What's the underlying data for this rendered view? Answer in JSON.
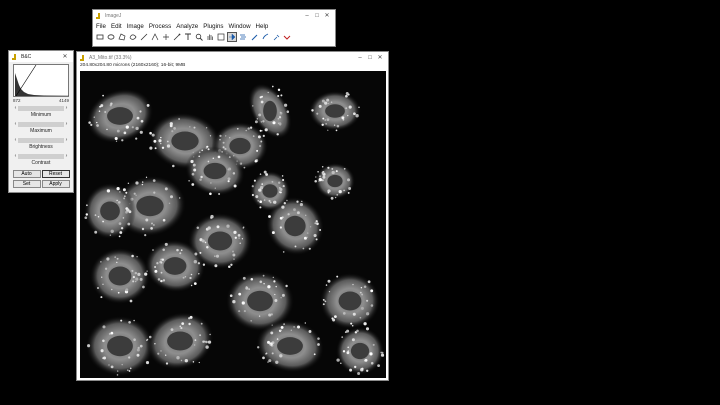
{
  "main_window": {
    "title": "ImageJ",
    "menus": [
      "File",
      "Edit",
      "Image",
      "Process",
      "Analyze",
      "Plugins",
      "Window",
      "Help"
    ],
    "tools": [
      "rectangle-tool",
      "oval-tool",
      "polygon-tool",
      "freehand-tool",
      "line-tool",
      "angle-tool",
      "point-tool",
      "wand-tool",
      "text-tool",
      "zoom-tool",
      "hand-tool",
      "color-picker-tool",
      "lut-tool",
      "stack-tool",
      "pencil-tool",
      "brush-tool",
      "dropper-tool",
      "more-tools"
    ]
  },
  "bc": {
    "title": "B&C",
    "min_value": "872",
    "max_value": "4149",
    "sliders": [
      "Minimum",
      "Maximum",
      "Brightness",
      "Contrast"
    ],
    "buttons": [
      "Auto",
      "Reset",
      "Set",
      "Apply"
    ]
  },
  "image_window": {
    "title": "A3_Mito.tif (33.3%)",
    "info": "204.80x204.80 microns (2160x2160); 16-bit; 9MB"
  }
}
